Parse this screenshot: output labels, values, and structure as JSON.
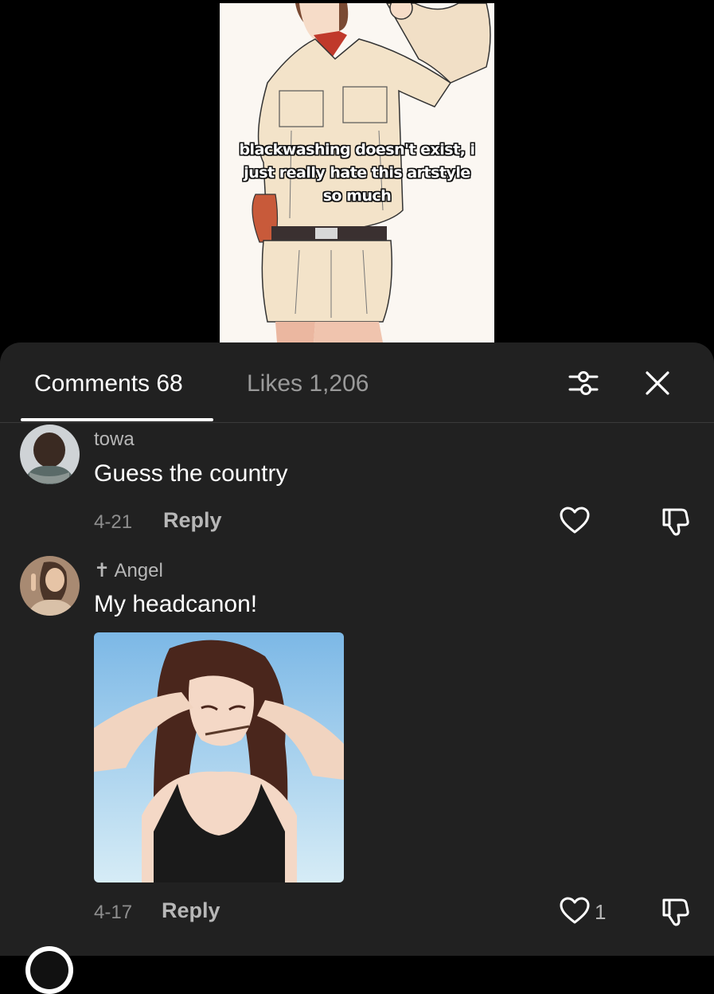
{
  "video": {
    "caption": "blackwashing doesn't exist, i just really hate this artstyle so much"
  },
  "sheet": {
    "tabs": {
      "comments_label": "Comments 68",
      "likes_label": "Likes 1,206"
    },
    "icons": {
      "filter": "sliders-icon",
      "close": "close-icon"
    }
  },
  "comments": [
    {
      "username": "towa",
      "text": "Guess the country",
      "date": "4-21",
      "reply_label": "Reply",
      "like_count": "",
      "has_image": false
    },
    {
      "username": "✝ Angel",
      "text": "My headcanon!",
      "date": "4-17",
      "reply_label": "Reply",
      "like_count": "1",
      "has_image": true
    }
  ],
  "colors": {
    "sheet_bg": "#212121",
    "active_tab": "#ffffff",
    "inactive_tab": "#9a9a9a",
    "secondary_text": "#b7b7b7"
  }
}
